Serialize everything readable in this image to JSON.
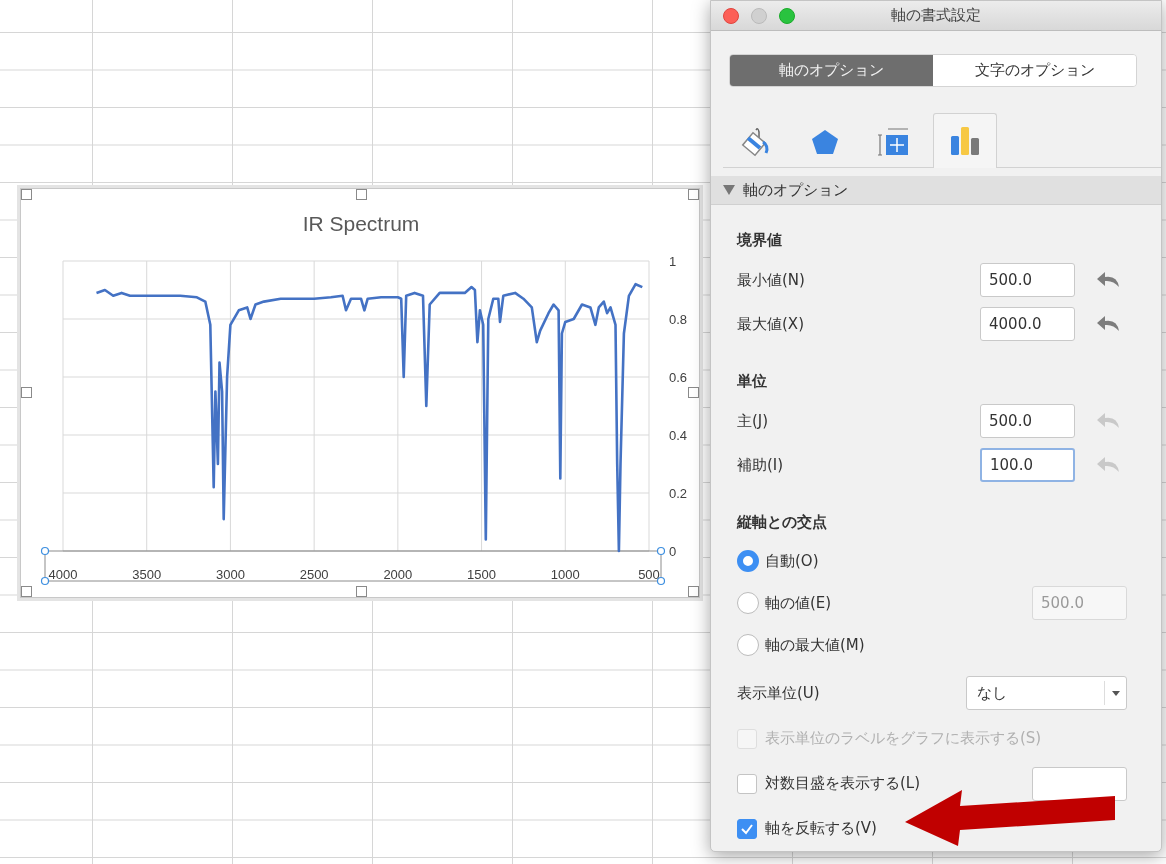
{
  "chart": {
    "selected": true,
    "axis_selected": true,
    "chart_data": {
      "type": "line",
      "title": "IR Spectrum",
      "grid": true,
      "xlim": [
        4000,
        500
      ],
      "ylim": [
        0,
        1
      ],
      "xticks": [
        4000,
        3500,
        3000,
        2500,
        2000,
        1500,
        1000,
        500
      ],
      "yticks": [
        0,
        0.2,
        0.4,
        0.6,
        0.8,
        1
      ],
      "x": [
        3800,
        3750,
        3700,
        3650,
        3600,
        3500,
        3400,
        3300,
        3200,
        3150,
        3120,
        3100,
        3090,
        3075,
        3065,
        3050,
        3040,
        3020,
        3000,
        2950,
        2900,
        2880,
        2850,
        2800,
        2700,
        2600,
        2500,
        2400,
        2330,
        2310,
        2280,
        2220,
        2200,
        2180,
        2100,
        2000,
        1980,
        1965,
        1950,
        1900,
        1850,
        1830,
        1810,
        1750,
        1700,
        1600,
        1560,
        1540,
        1525,
        1510,
        1490,
        1475,
        1460,
        1430,
        1400,
        1390,
        1370,
        1300,
        1250,
        1200,
        1170,
        1150,
        1100,
        1070,
        1040,
        1030,
        1020,
        1000,
        950,
        900,
        850,
        820,
        800,
        770,
        750,
        730,
        700,
        690,
        680,
        670,
        650,
        620,
        580,
        540
      ],
      "series": [
        {
          "color": "#4472c4",
          "values": [
            0.89,
            0.9,
            0.88,
            0.89,
            0.88,
            0.88,
            0.88,
            0.88,
            0.875,
            0.86,
            0.78,
            0.22,
            0.55,
            0.3,
            0.65,
            0.55,
            0.11,
            0.6,
            0.78,
            0.83,
            0.84,
            0.8,
            0.85,
            0.86,
            0.87,
            0.87,
            0.87,
            0.875,
            0.88,
            0.83,
            0.87,
            0.87,
            0.83,
            0.87,
            0.875,
            0.875,
            0.87,
            0.6,
            0.88,
            0.89,
            0.88,
            0.5,
            0.85,
            0.89,
            0.89,
            0.89,
            0.91,
            0.9,
            0.72,
            0.83,
            0.78,
            0.04,
            0.8,
            0.87,
            0.87,
            0.79,
            0.88,
            0.89,
            0.87,
            0.84,
            0.72,
            0.76,
            0.82,
            0.85,
            0.83,
            0.25,
            0.75,
            0.79,
            0.8,
            0.85,
            0.84,
            0.78,
            0.84,
            0.86,
            0.82,
            0.84,
            0.78,
            0.3,
            0.0,
            0.3,
            0.75,
            0.88,
            0.92,
            0.91
          ]
        }
      ]
    }
  },
  "window": {
    "title": "軸の書式設定"
  },
  "segments": [
    {
      "label": "軸のオプション",
      "selected": true
    },
    {
      "label": "文字のオプション",
      "selected": false
    }
  ],
  "icon_tabs": [
    {
      "kind": "fill",
      "selected": false
    },
    {
      "kind": "effects",
      "selected": false
    },
    {
      "kind": "size",
      "selected": false
    },
    {
      "kind": "axis",
      "selected": true
    }
  ],
  "section": {
    "title": "軸のオプション",
    "expanded": true
  },
  "groups": [
    {
      "heading": "境界値",
      "fields": [
        {
          "label": "最小値(N)",
          "value": "500.0",
          "reset_enabled": true,
          "focused": false
        },
        {
          "label": "最大値(X)",
          "value": "4000.0",
          "reset_enabled": true,
          "focused": false
        }
      ]
    },
    {
      "heading": "単位",
      "fields": [
        {
          "label": "主(J)",
          "value": "500.0",
          "reset_enabled": false,
          "focused": false
        },
        {
          "label": "補助(I)",
          "value": "100.0",
          "reset_enabled": false,
          "focused": true
        }
      ]
    }
  ],
  "crosses": {
    "heading": "縦軸との交点",
    "options": [
      {
        "label": "自動(O)",
        "selected": true
      },
      {
        "label": "軸の値(E)",
        "selected": false,
        "placeholder": "500.0",
        "value_disabled": true
      },
      {
        "label": "軸の最大値(M)",
        "selected": false
      }
    ]
  },
  "display_unit": {
    "label": "表示単位(U)",
    "value": "なし"
  },
  "checkboxes": [
    {
      "label": "表示単位のラベルをグラフに表示する(S)",
      "checked": false,
      "disabled": true,
      "kind": "plain"
    },
    {
      "label": "対数目盛を表示する(L)",
      "checked": false,
      "disabled": false,
      "kind": "field"
    },
    {
      "label": "軸を反転する(V)",
      "checked": true,
      "disabled": false,
      "kind": "plain"
    }
  ]
}
